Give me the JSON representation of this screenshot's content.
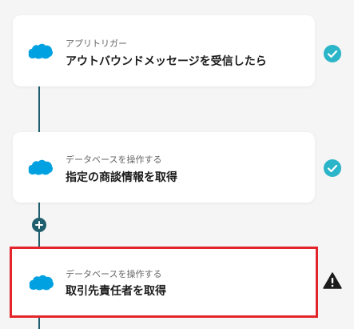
{
  "flow": {
    "steps": [
      {
        "subtitle": "アプリトリガー",
        "title": "アウトバウンドメッセージを受信したら",
        "status_icon": "check-circle-icon",
        "app_icon": "salesforce-icon"
      },
      {
        "subtitle": "データベースを操作する",
        "title": "指定の商談情報を取得",
        "status_icon": "check-circle-icon",
        "app_icon": "salesforce-icon"
      },
      {
        "subtitle": "データベースを操作する",
        "title": "取引先責任者を取得",
        "status_icon": "warning-icon",
        "app_icon": "salesforce-icon",
        "highlighted": true
      }
    ],
    "add_step_icon": "plus-icon"
  },
  "colors": {
    "connector": "#1f5f6e",
    "check": "#2bb5c8",
    "warning": "#1b1b1b",
    "highlight": "#e3252b",
    "salesforce": "#00a1e0"
  }
}
